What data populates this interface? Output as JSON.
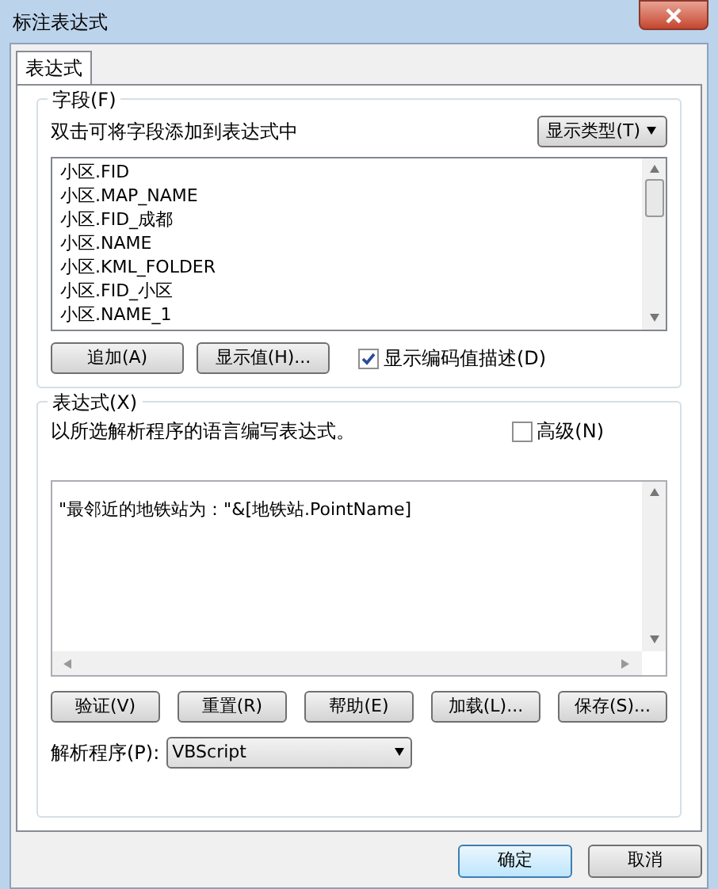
{
  "window": {
    "title": "标注表达式"
  },
  "tabs": [
    {
      "label": "表达式",
      "selected": true
    }
  ],
  "fields_group": {
    "title": "字段(F)",
    "hint": "双击可将字段添加到表达式中",
    "type_button": "显示类型(T)",
    "items": [
      "小区.FID",
      "小区.MAP_NAME",
      "小区.FID_成都",
      "小区.NAME",
      "小区.KML_FOLDER",
      "小区.FID_小区",
      "小区.NAME_1"
    ],
    "buttons": [
      "追加(A)",
      "显示值(H)..."
    ],
    "show_coded": {
      "label": "显示编码值描述(D)",
      "checked": true
    }
  },
  "expression_group": {
    "title": "表达式(X)",
    "hint": "以所选解析程序的语言编写表达式。",
    "advanced": {
      "label": "高级(N)",
      "checked": false
    },
    "expression": "\"最邻近的地铁站为：\"&[地铁站.PointName]",
    "buttons": [
      "验证(V)",
      "重置(R)",
      "帮助(E)",
      "加载(L)...",
      "保存(S)..."
    ],
    "parser_label": "解析程序(P):",
    "parser_value": "VBScript"
  },
  "footer_buttons": [
    {
      "label": "确定",
      "default": true
    },
    {
      "label": "取消",
      "default": false
    }
  ]
}
